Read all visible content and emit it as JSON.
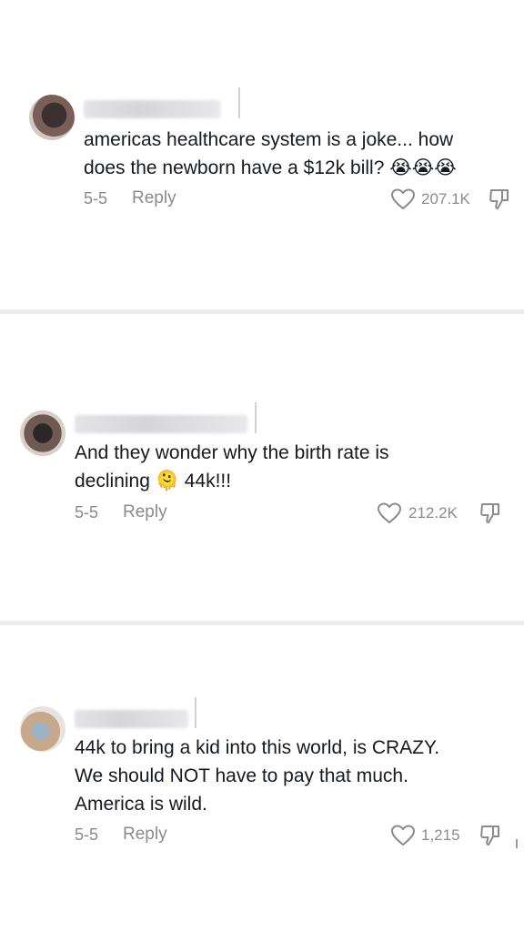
{
  "comments": [
    {
      "text_lines": [
        "americas healthcare system is a joke... how",
        "does the newborn have a $12k bill? 😭😭😭"
      ],
      "date": "5-5",
      "reply_label": "Reply",
      "like_count": "207.1K"
    },
    {
      "text_lines": [
        "And they wonder why the birth rate is",
        "declining 🫠 44k!!!"
      ],
      "date": "5-5",
      "reply_label": "Reply",
      "like_count": "212.2K"
    },
    {
      "text_lines": [
        "44k to bring a kid into this world, is CRAZY.",
        "We should NOT have to pay that much.",
        "America is wild."
      ],
      "date": "5-5",
      "reply_label": "Reply",
      "like_count": "1,215"
    }
  ],
  "icons": {
    "like": "heart-outline-icon",
    "dislike": "thumbs-down-icon"
  }
}
